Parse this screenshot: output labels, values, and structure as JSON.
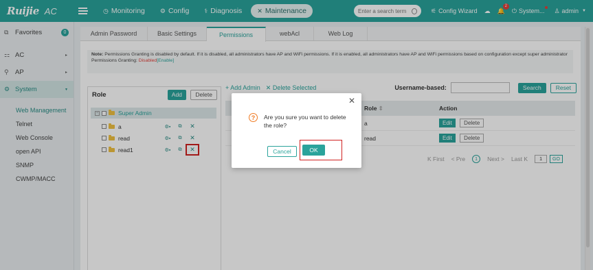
{
  "app": {
    "brand": "Ruijie",
    "product": "AC"
  },
  "topnav": {
    "items": [
      {
        "label": "Monitoring",
        "icon": "dashboard-icon"
      },
      {
        "label": "Config",
        "icon": "gear-icon"
      },
      {
        "label": "Diagnosis",
        "icon": "stethoscope-icon"
      },
      {
        "label": "Maintenance",
        "icon": "tools-icon",
        "active": true
      }
    ],
    "search_placeholder": "Enter a search term",
    "config_wizard": "Config Wizard",
    "notification_count": "2",
    "system_label": "System...",
    "user_label": "admin"
  },
  "sidebar": {
    "favorites": {
      "label": "Favorites",
      "count": "0"
    },
    "items": [
      {
        "label": "AC",
        "arrow": "▸"
      },
      {
        "label": "AP",
        "arrow": "▸"
      },
      {
        "label": "System",
        "arrow": "▾",
        "active": true
      }
    ],
    "subitems": [
      "Web Management",
      "Telnet",
      "Web Console",
      "open API",
      "SNMP",
      "CWMP/MACC"
    ]
  },
  "tabs": [
    "Admin Password",
    "Basic Settings",
    "Permissions",
    "webAcl",
    "Web Log"
  ],
  "note": {
    "label": "Note:",
    "text": "Permissions Granting is disabled by default. If it is disabled, all administrators have AP and WiFi permissions. If it is enabled, all administrators have AP and WiFi permissions based on configuration except super administrator",
    "granting_label": "Permissions Granting:",
    "granting_status": "Disabled",
    "enable_link": "[Enable]"
  },
  "role_panel": {
    "title": "Role",
    "add": "Add",
    "delete": "Delete",
    "root": "Super Admin",
    "children": [
      "a",
      "read",
      "read1"
    ]
  },
  "right_panel": {
    "add_admin": "+ Add Admin",
    "delete_selected": "✕ Delete Selected",
    "username_label": "Username-based:",
    "search": "Search",
    "reset": "Reset",
    "table": {
      "col_role": "Role",
      "col_action": "Action",
      "rows": [
        {
          "role": "a",
          "edit": "Edit",
          "delete": "Delete"
        },
        {
          "role": "read",
          "edit": "Edit",
          "delete": "Delete"
        }
      ]
    },
    "pager": {
      "first": "K First",
      "prev": "< Pre",
      "current": "1",
      "next": "Next >",
      "last": "Last K",
      "page_input": "1",
      "go": "GO"
    }
  },
  "dialog": {
    "message": "Are you sure you want to delete the role?",
    "cancel": "Cancel",
    "ok": "OK"
  },
  "colors": {
    "accent": "#2aa39b",
    "highlight": "#d0201f",
    "warning": "#f07a22",
    "disabled": "#e0403a"
  }
}
